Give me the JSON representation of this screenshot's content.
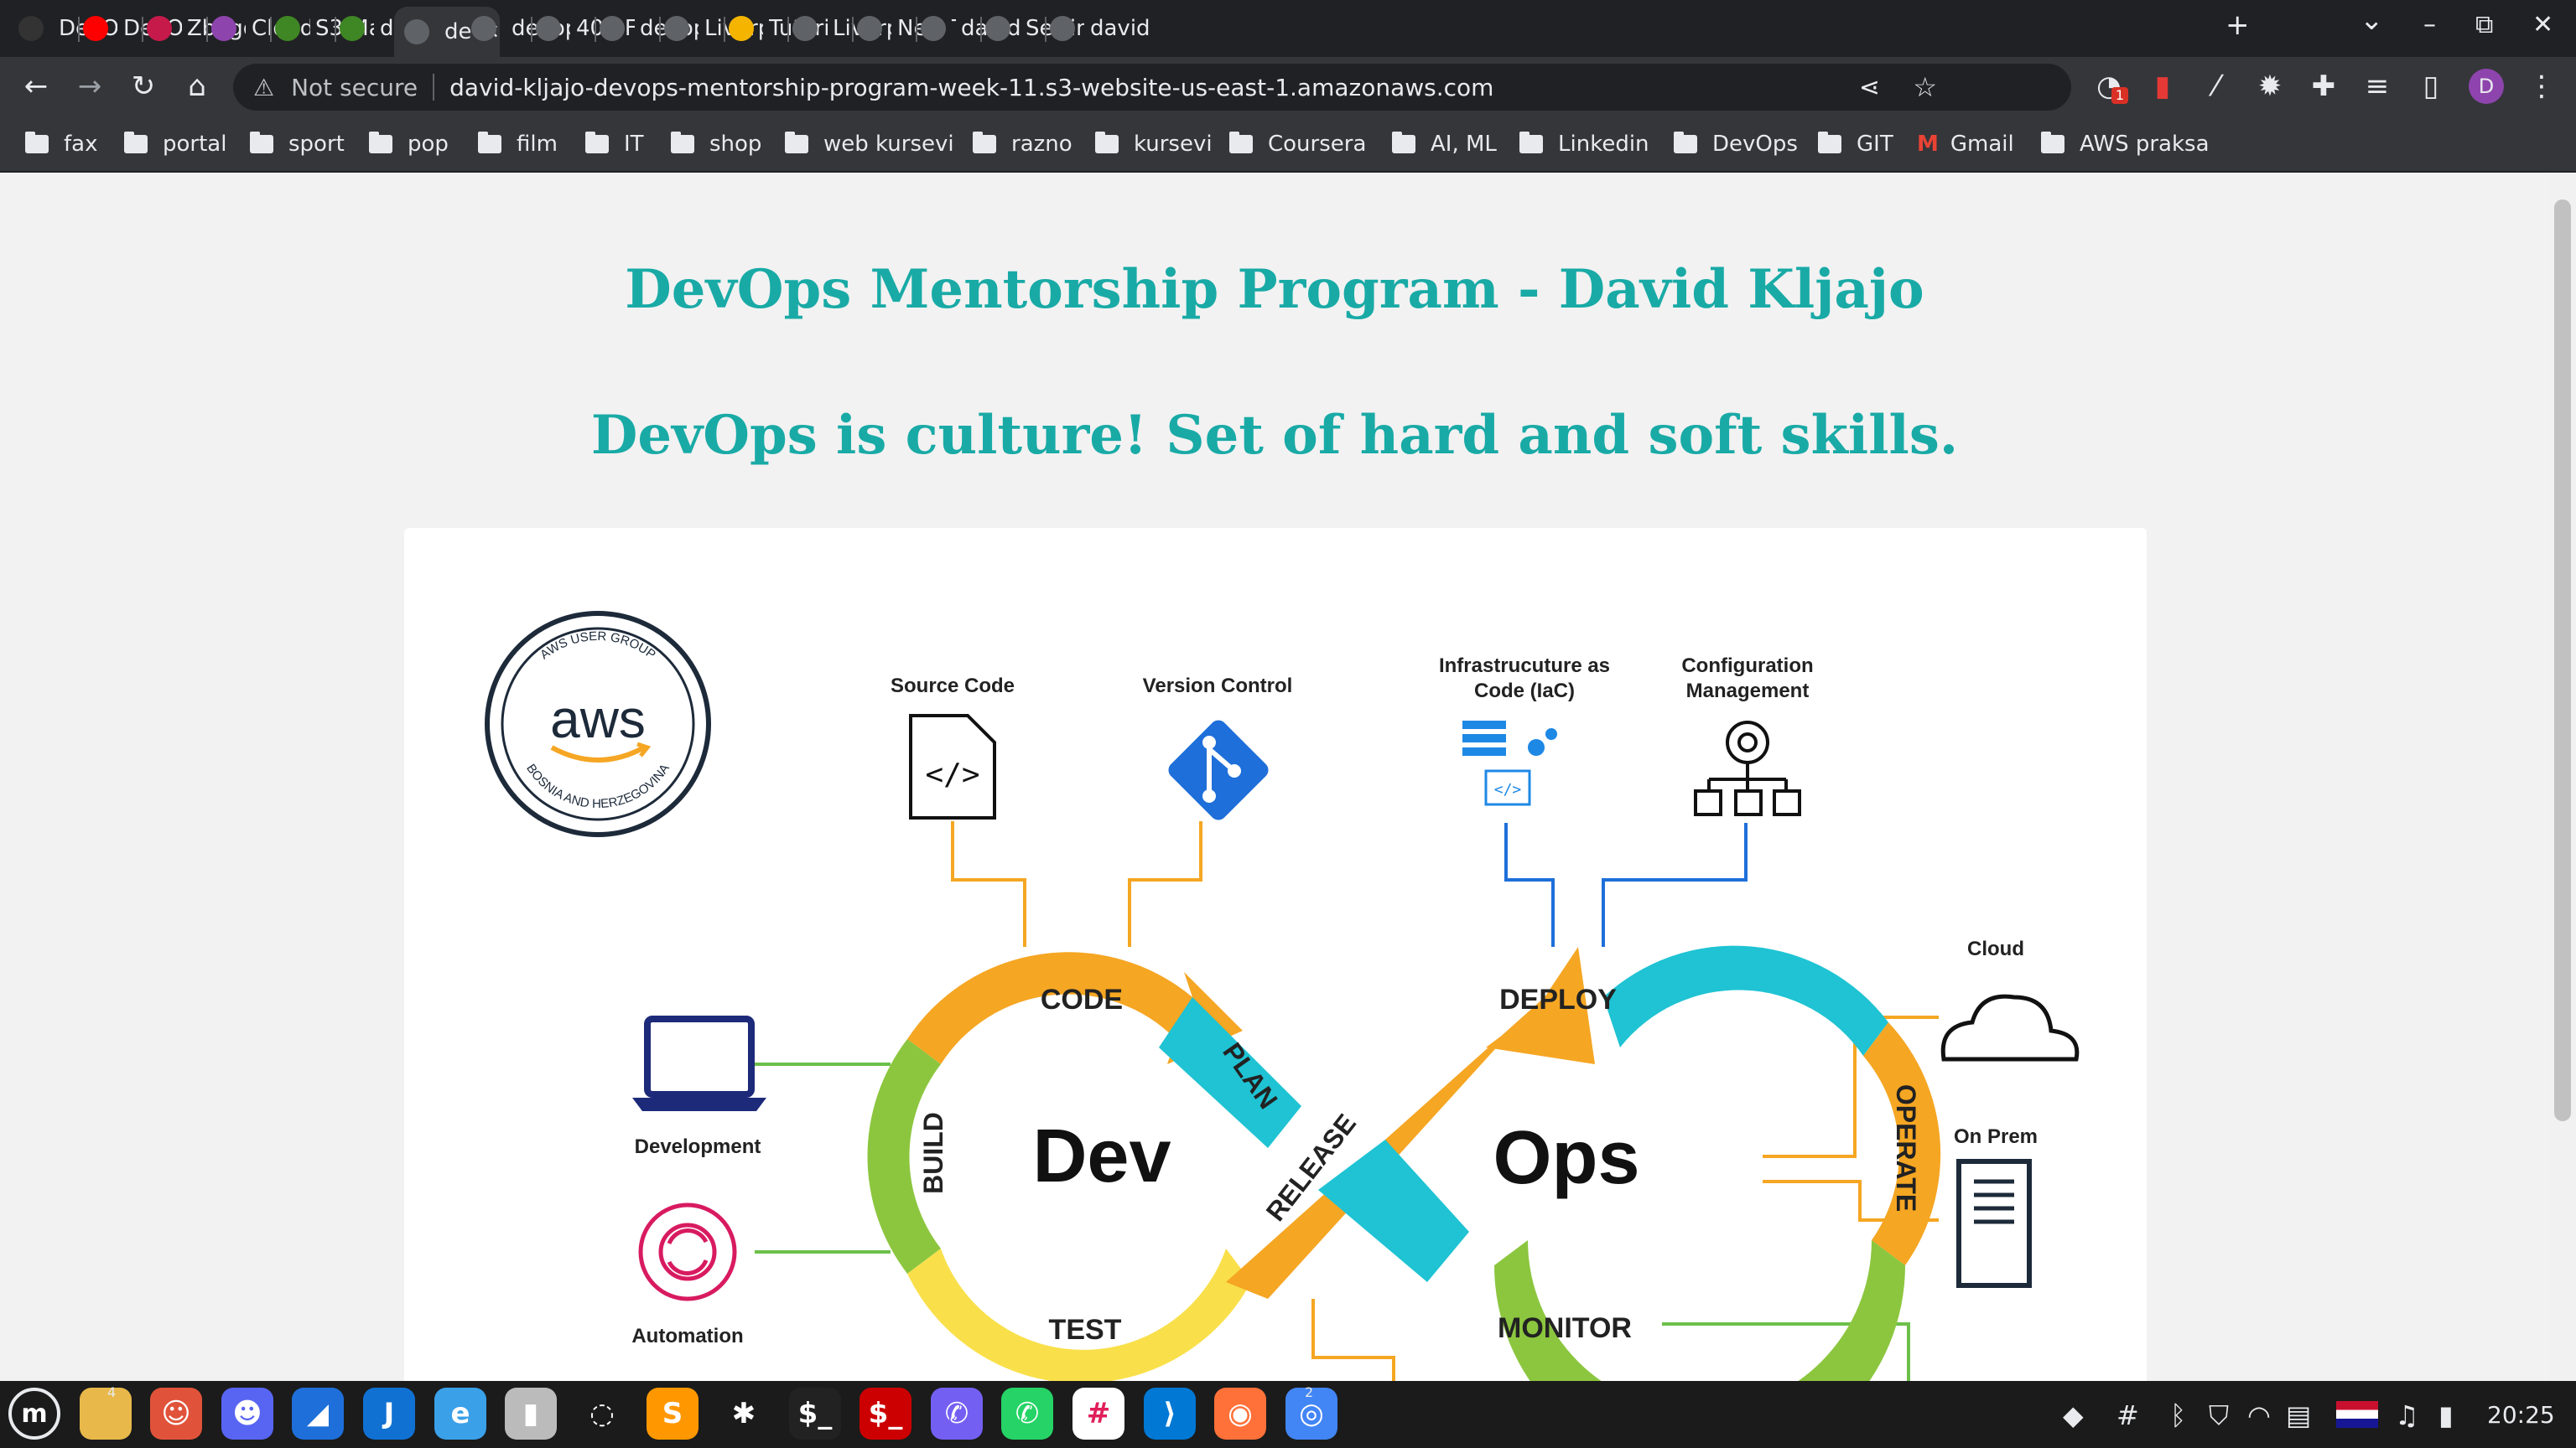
{
  "browser": {
    "tabs": [
      {
        "label": "DevO",
        "icon": "github-icon",
        "color": "#333"
      },
      {
        "label": "DevO",
        "icon": "youtube-icon",
        "color": "#ff0000"
      },
      {
        "label": "Zbogo",
        "icon": "raspberry-icon",
        "color": "#c51a4a"
      },
      {
        "label": "Cloud",
        "icon": "cloud-app-icon",
        "color": "#8e44ad"
      },
      {
        "label": "S3 Ma",
        "icon": "s3-icon",
        "color": "#3f8624"
      },
      {
        "label": "david-",
        "icon": "s3-icon",
        "color": "#3f8624"
      },
      {
        "label": "de",
        "icon": "globe-icon",
        "color": "#5f6368",
        "active": true
      },
      {
        "label": "devop",
        "icon": "globe-icon",
        "color": "#5f6368"
      },
      {
        "label": "403 Fo",
        "icon": "globe-icon",
        "color": "#5f6368"
      },
      {
        "label": "devop",
        "icon": "globe-icon",
        "color": "#5f6368"
      },
      {
        "label": "Liverp",
        "icon": "chrome-ext-icon",
        "color": "#5f6368"
      },
      {
        "label": "Tutori",
        "icon": "box-icon",
        "color": "#f4b400"
      },
      {
        "label": "Liverp",
        "icon": "chrome-ext-icon",
        "color": "#5f6368"
      },
      {
        "label": "New T",
        "icon": "shield-icon",
        "color": "#5f6368"
      },
      {
        "label": "david-",
        "icon": "globe-icon",
        "color": "#5f6368"
      },
      {
        "label": "Settin",
        "icon": "gear-icon",
        "color": "#5f6368"
      },
      {
        "label": "david-",
        "icon": "globe-icon",
        "color": "#5f6368"
      }
    ],
    "omnibox": {
      "security_label": "Not secure",
      "url": "david-kljajo-devops-mentorship-program-week-11.s3-website-us-east-1.amazonaws.com"
    },
    "profile_initial": "D",
    "extension_badge": "1",
    "bookmarks": [
      "fax",
      "portal",
      "sport",
      "pop",
      "film",
      "IT",
      "shop",
      "web kursevi",
      "razno",
      "kursevi",
      "Coursera",
      "AI, ML",
      "Linkedin",
      "DevOps",
      "GIT",
      "Gmail",
      "AWS praksa"
    ]
  },
  "page": {
    "heading1": "DevOps Mentorship Program - David Kljajo",
    "heading2": "DevOps is culture! Set of hard and soft skills."
  },
  "diagram": {
    "badge_top": "AWS USER GROUP",
    "badge_logo": "aws",
    "badge_bottom": "BOSNIA AND HERZEGOVINA",
    "source_code": "Source Code",
    "version_control": "Version Control",
    "iac_line1": "Infrastrucuture as",
    "iac_line2": "Code (IaC)",
    "config_line1": "Configuration",
    "config_line2": "Management",
    "cloud": "Cloud",
    "on_prem": "On Prem",
    "development": "Development",
    "automation": "Automation",
    "code": "CODE",
    "plan": "PLAN",
    "build": "BUILD",
    "test": "TEST",
    "release": "RELEASE",
    "deploy": "DEPLOY",
    "operate": "OPERATE",
    "monitor": "MONITOR",
    "dev": "Dev",
    "ops": "Ops",
    "colors": {
      "orange": "#f5a623",
      "teal": "#1fc3d3",
      "green": "#8cc63f",
      "yellow": "#f9e04b",
      "blue": "#1e6fd9"
    }
  },
  "taskbar": {
    "apps": [
      {
        "name": "mint-menu-icon",
        "glyph": "m",
        "color": "#1b1b1b"
      },
      {
        "name": "files-icon",
        "glyph": "",
        "color": "#e8b94a"
      },
      {
        "name": "gimp-icon",
        "glyph": "☺",
        "color": "#e0533a"
      },
      {
        "name": "discord-icon",
        "glyph": "☻",
        "color": "#5865f2"
      },
      {
        "name": "shark-icon",
        "glyph": "◢",
        "color": "#1e6fd9"
      },
      {
        "name": "joplin-icon",
        "glyph": "J",
        "color": "#1071d3"
      },
      {
        "name": "edge-icon",
        "glyph": "e",
        "color": "#3aa0e8"
      },
      {
        "name": "document-icon",
        "glyph": "▮",
        "color": "#bbbbbb"
      },
      {
        "name": "jupyter-icon",
        "glyph": "◌",
        "color": "#1b1b1b"
      },
      {
        "name": "sublime-icon",
        "glyph": "S",
        "color": "#ff9800"
      },
      {
        "name": "spider-icon",
        "glyph": "✱",
        "color": "#1b1b1b"
      },
      {
        "name": "terminal-icon",
        "glyph": "$_",
        "color": "#222"
      },
      {
        "name": "terminal-red-icon",
        "glyph": "$_",
        "color": "#cc0000"
      },
      {
        "name": "viber-icon",
        "glyph": "✆",
        "color": "#7360f2"
      },
      {
        "name": "whatsapp-icon",
        "glyph": "✆",
        "color": "#25d366"
      },
      {
        "name": "slack-icon",
        "glyph": "#",
        "color": "#ffffff"
      },
      {
        "name": "vscode-icon",
        "glyph": "⟩",
        "color": "#0078d4"
      },
      {
        "name": "firefox-icon",
        "glyph": "◉",
        "color": "#ff7139"
      },
      {
        "name": "chrome-icon",
        "glyph": "◎",
        "color": "#4285f4"
      }
    ],
    "badges": {
      "files": "4",
      "chrome": "2"
    },
    "clock": "20:25"
  }
}
